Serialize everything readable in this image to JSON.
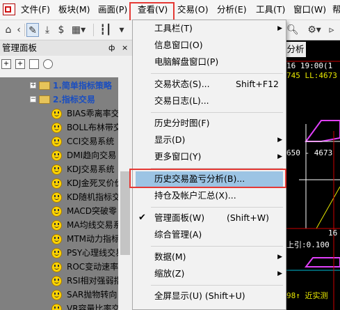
{
  "menubar": {
    "items": [
      "文件(F)",
      "板块(M)",
      "画面(P)",
      "查看(V)",
      "交易(O)",
      "分析(E)",
      "工具(T)",
      "窗口(W)",
      "帮"
    ]
  },
  "toolbar": {
    "icons": [
      "home-icon",
      "back-icon",
      "pen-icon",
      "download-icon",
      "refresh-dollar-icon",
      "grid-icon",
      "bar-chart-icon",
      "zoom-icon",
      "settings-icon"
    ]
  },
  "panel": {
    "title": "管理面板",
    "pin": "ф",
    "close": "×",
    "folders": [
      "1.简单指标策略",
      "2.指标交易"
    ],
    "items": [
      "BIAS乖离率交",
      "BOLL布林带交",
      "CCI交易系统",
      "DMI趋向交易",
      "KDJ交易系统",
      "KDJ金死叉价价",
      "KD随机指标交",
      "MACD突破零",
      "MA均线交易系",
      "MTM动力指标",
      "PSY心理线交易",
      "ROC变动速率",
      "RSI相对强弱指",
      "SAR抛物转向",
      "VR容量比率交"
    ]
  },
  "chart": {
    "tab": "分析",
    "lines": [
      "16 19:00(1",
      "745 LL:4673",
      "650 - 4673",
      "上引:0.100",
      "16",
      "98↑ 近实测"
    ]
  },
  "dropdown": {
    "items": [
      {
        "label": "工具栏(T)",
        "submenu": true
      },
      {
        "label": "信息窗口(O)"
      },
      {
        "label": "电脑解盘窗口(P)"
      },
      {
        "label": "交易状态(S)...",
        "shortcut": "Shift+F12"
      },
      {
        "label": "交易日志(L)..."
      },
      {
        "label": "历史分时图(F)"
      },
      {
        "label": "显示(D)",
        "submenu": true
      },
      {
        "label": "更多窗口(Y)",
        "submenu": true
      },
      {
        "label": "历史交易盈亏分析(B)..."
      },
      {
        "label": "持仓及帐户汇总(X)..."
      },
      {
        "label": "管理面板(W)",
        "shortcut": "(Shift+W)",
        "checked": true
      },
      {
        "label": "综合管理(A)"
      },
      {
        "label": "数据(M)",
        "submenu": true
      },
      {
        "label": "缩放(Z)",
        "submenu": true
      },
      {
        "label": "全屏显示(U) (Shift+U)"
      }
    ],
    "check": "✔",
    "arrow": "▶"
  },
  "colors": {
    "highlight_box": "#e53935",
    "selected_bg": "#9cc4e4",
    "folder_text": "#1a4ec0",
    "chart_bg": "#000000"
  }
}
